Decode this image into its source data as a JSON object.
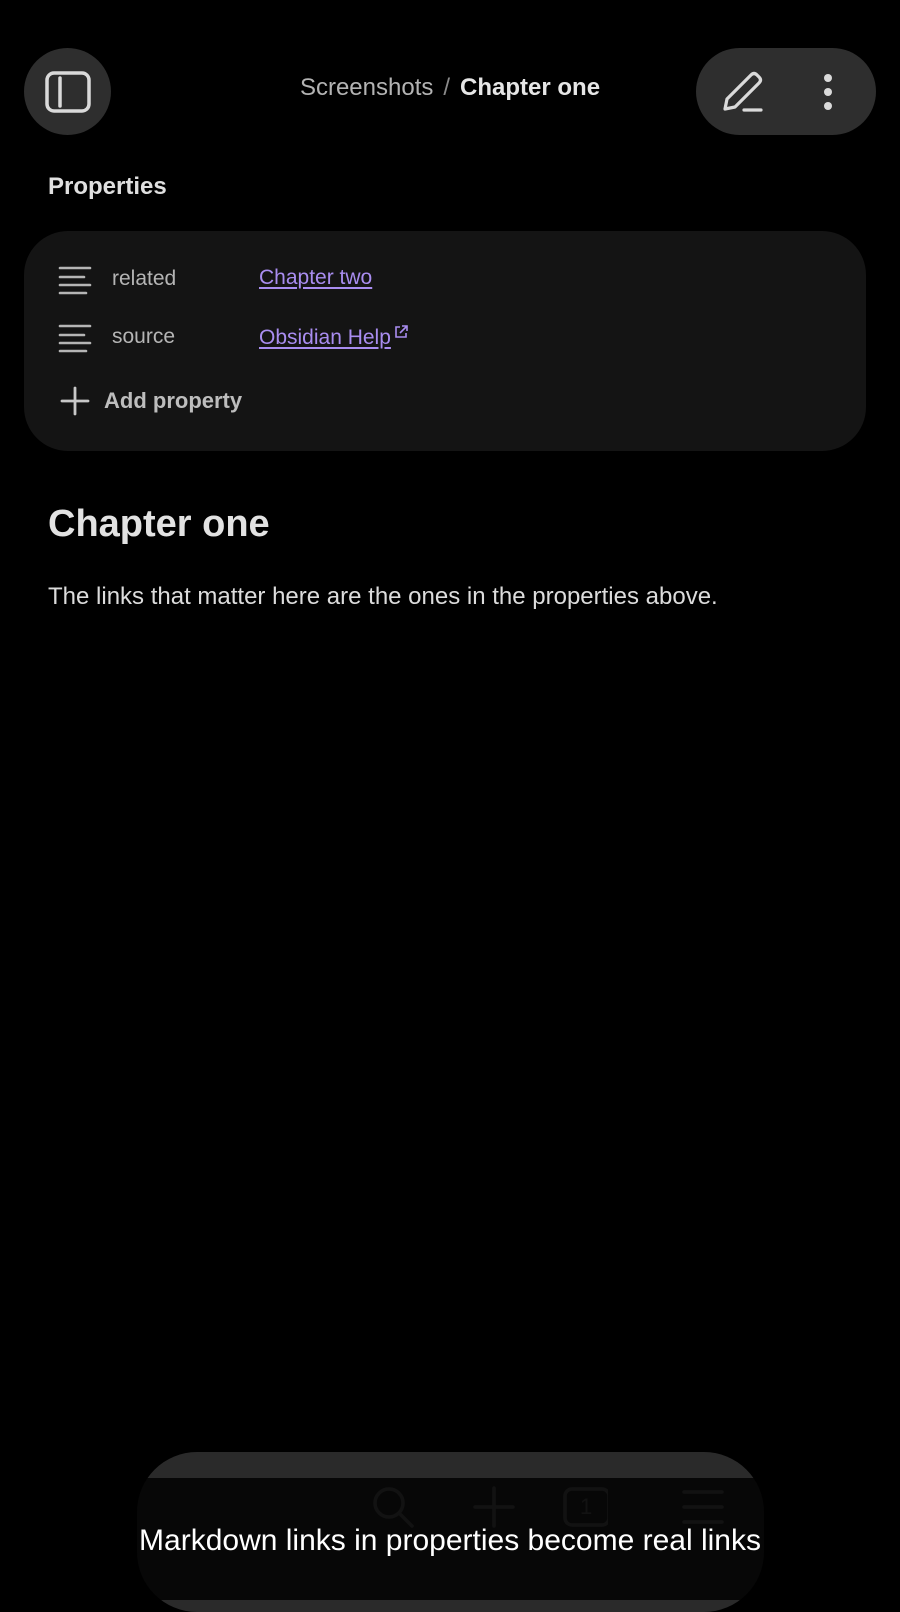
{
  "header": {
    "breadcrumb_parent": "Screenshots",
    "breadcrumb_separator": "/",
    "breadcrumb_current": "Chapter one",
    "sidebar_toggle_icon": "sidebar-toggle-icon",
    "edit_icon": "pencil-icon",
    "more_icon": "more-vertical-icon"
  },
  "properties": {
    "heading": "Properties",
    "items": [
      {
        "key": "related",
        "value": "Chapter two",
        "icon": "text-lines-icon",
        "external": false
      },
      {
        "key": "source",
        "value": "Obsidian Help",
        "icon": "text-lines-icon",
        "external": true
      }
    ],
    "add_label": "Add property"
  },
  "note": {
    "title": "Chapter one",
    "body": "The links that matter here are the ones in the properties above."
  },
  "toolbar": {
    "icons": [
      "search-icon",
      "plus-icon",
      "tabs-icon",
      "menu-icon"
    ],
    "tab_count": "1"
  },
  "caption": "Markdown links in properties become real links",
  "colors": {
    "background": "#000000",
    "surface": "#141414",
    "button": "#2e2e2e",
    "link": "#a98df0"
  }
}
